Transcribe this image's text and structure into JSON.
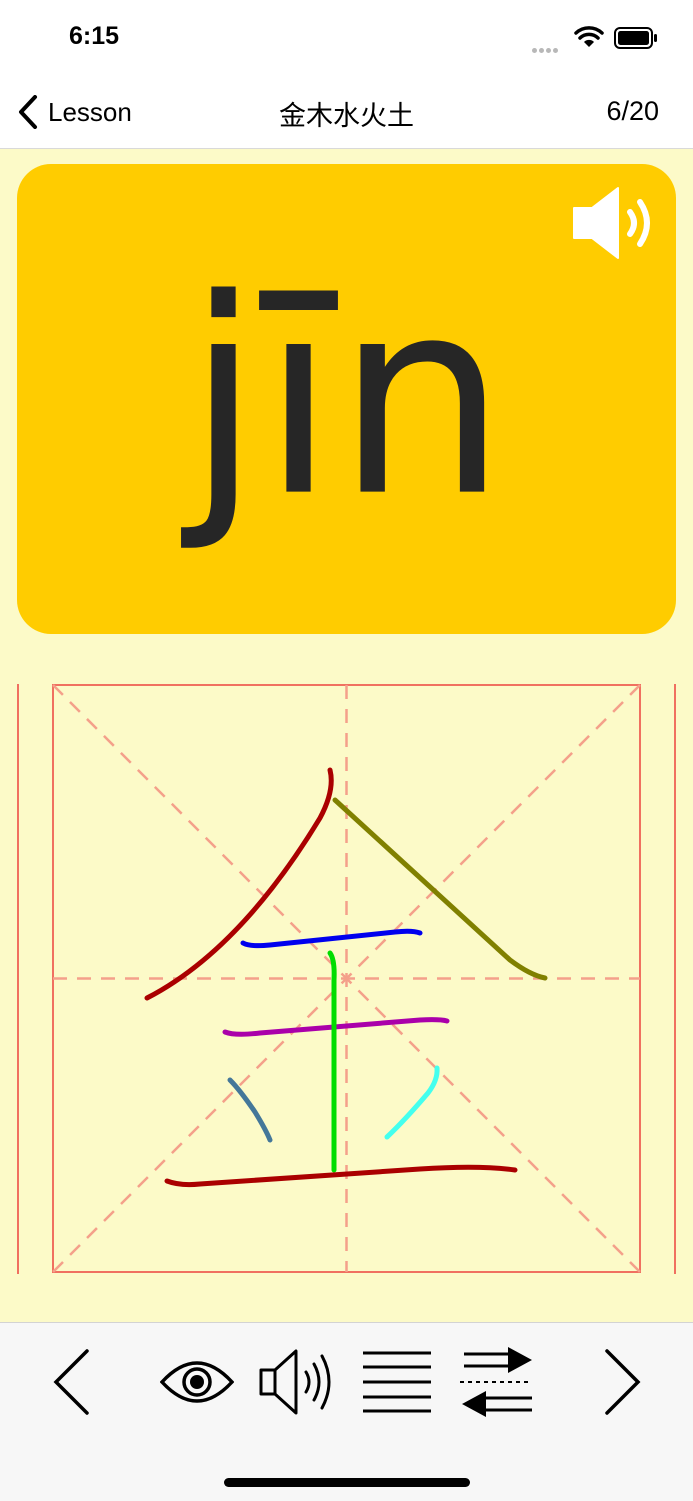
{
  "status_bar": {
    "time": "6:15"
  },
  "nav": {
    "back_label": "Lesson",
    "title": "金木水火土",
    "counter": "6/20"
  },
  "card": {
    "pinyin": "jīn",
    "background_color": "#FFCC00",
    "speaker_icon": "speaker-wave-icon"
  },
  "character_grid": {
    "character": "金",
    "grid_color": "#F07060",
    "stroke_colors": [
      "#AA0000",
      "#808000",
      "#0000EE",
      "#AA00AA",
      "#00DD00",
      "#447799",
      "#44FFEE",
      "#AA0000"
    ]
  },
  "toolbar": {
    "items": [
      {
        "icon": "chevron-left-icon"
      },
      {
        "icon": "eye-icon"
      },
      {
        "icon": "speaker-icon"
      },
      {
        "icon": "lines-icon"
      },
      {
        "icon": "swap-arrows-icon"
      },
      {
        "icon": "chevron-right-icon"
      }
    ]
  }
}
